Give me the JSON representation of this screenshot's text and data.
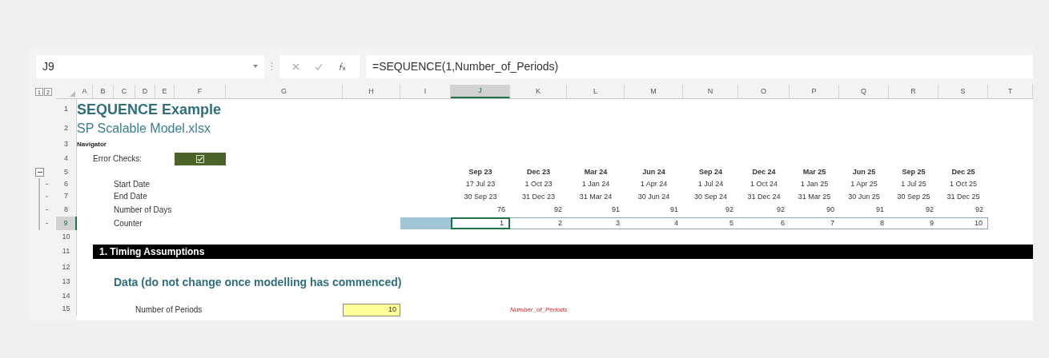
{
  "formula_bar": {
    "name_box": "J9",
    "formula": "=SEQUENCE(1,Number_of_Periods)"
  },
  "outline_levels": [
    "1",
    "2"
  ],
  "columns": [
    {
      "label": "A",
      "selected": false
    },
    {
      "label": "B",
      "selected": false
    },
    {
      "label": "C",
      "selected": false
    },
    {
      "label": "D",
      "selected": false
    },
    {
      "label": "E",
      "selected": false
    },
    {
      "label": "F",
      "selected": false
    },
    {
      "label": "G",
      "selected": false
    },
    {
      "label": "H",
      "selected": false
    },
    {
      "label": "I",
      "selected": false
    },
    {
      "label": "J",
      "selected": true
    },
    {
      "label": "K",
      "selected": false
    },
    {
      "label": "L",
      "selected": false
    },
    {
      "label": "M",
      "selected": false
    },
    {
      "label": "N",
      "selected": false
    },
    {
      "label": "O",
      "selected": false
    },
    {
      "label": "P",
      "selected": false
    },
    {
      "label": "Q",
      "selected": false
    },
    {
      "label": "R",
      "selected": false
    },
    {
      "label": "S",
      "selected": false
    },
    {
      "label": "T",
      "selected": false
    }
  ],
  "rows": [
    {
      "number": "1",
      "selected": false,
      "grouped": false,
      "kind": "title",
      "text": "SEQUENCE Example"
    },
    {
      "number": "2",
      "selected": false,
      "grouped": false,
      "kind": "subtitle",
      "text": "SP Scalable Model.xlsx"
    },
    {
      "number": "3",
      "selected": false,
      "grouped": false,
      "kind": "navigator",
      "text": "Navigator"
    },
    {
      "number": "4",
      "selected": false,
      "grouped": false,
      "kind": "checks",
      "label": "Error Checks:"
    },
    {
      "number": "5",
      "selected": false,
      "grouped": true,
      "kind": "period-headers",
      "values": [
        "Sep 23",
        "Dec 23",
        "Mar 24",
        "Jun 24",
        "Sep 24",
        "Dec 24",
        "Mar 25",
        "Jun 25",
        "Sep 25",
        "Dec 25"
      ]
    },
    {
      "number": "6",
      "selected": false,
      "grouped": true,
      "kind": "dates",
      "label": "Start Date",
      "values": [
        "17 Jul 23",
        "1 Oct 23",
        "1 Jan 24",
        "1 Apr 24",
        "1 Jul 24",
        "1 Oct 24",
        "1 Jan 25",
        "1 Apr 25",
        "1 Jul 25",
        "1 Oct 25"
      ]
    },
    {
      "number": "7",
      "selected": false,
      "grouped": true,
      "kind": "dates",
      "label": "End Date",
      "values": [
        "30 Sep 23",
        "31 Dec 23",
        "31 Mar 24",
        "30 Jun 24",
        "30 Sep 24",
        "31 Dec 24",
        "31 Mar 25",
        "30 Jun 25",
        "30 Sep 25",
        "31 Dec 25"
      ]
    },
    {
      "number": "8",
      "selected": false,
      "grouped": true,
      "kind": "numbers",
      "label": "Number of Days",
      "values": [
        "76",
        "92",
        "91",
        "91",
        "92",
        "92",
        "90",
        "91",
        "92",
        "92"
      ]
    },
    {
      "number": "9",
      "selected": true,
      "grouped": true,
      "kind": "counter",
      "label": "Counter",
      "values": [
        {
          "text": "1",
          "selected": true
        },
        {
          "text": "2",
          "selected": false
        },
        {
          "text": "3",
          "selected": false
        },
        {
          "text": "4",
          "selected": false
        },
        {
          "text": "5",
          "selected": false
        },
        {
          "text": "6",
          "selected": false
        },
        {
          "text": "7",
          "selected": false
        },
        {
          "text": "8",
          "selected": false
        },
        {
          "text": "9",
          "selected": false
        },
        {
          "text": "10",
          "selected": false
        }
      ]
    },
    {
      "number": "10",
      "selected": false,
      "grouped": false,
      "kind": "blank"
    },
    {
      "number": "11",
      "selected": false,
      "grouped": false,
      "kind": "section",
      "text": "1.  Timing Assumptions"
    },
    {
      "number": "12",
      "selected": false,
      "grouped": false,
      "kind": "blank"
    },
    {
      "number": "13",
      "selected": false,
      "grouped": false,
      "kind": "heading",
      "text": "Data (do not change once modelling has commenced)"
    },
    {
      "number": "14",
      "selected": false,
      "grouped": false,
      "kind": "blank"
    },
    {
      "number": "15",
      "selected": false,
      "grouped": false,
      "kind": "input",
      "label": "Number of Periods",
      "value": "10",
      "name_ref": "Number_of_Periods"
    }
  ]
}
